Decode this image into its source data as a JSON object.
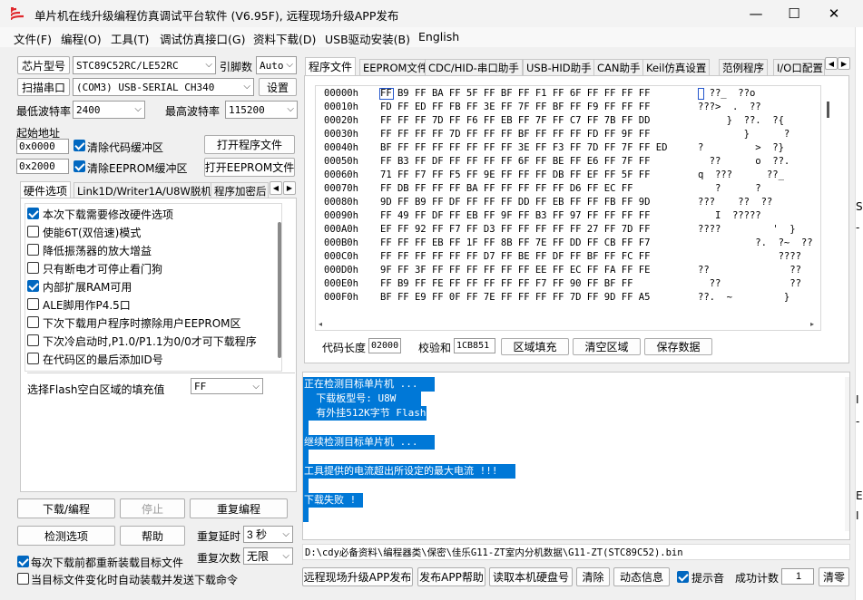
{
  "window": {
    "title": "单片机在线升级编程仿真调试平台软件 (V6.95F), 远程现场升级APP发布",
    "minimize": "—",
    "maximize": "☐",
    "close": "✕"
  },
  "menu": [
    "文件(F)",
    "编程(O)",
    "工具(T)",
    "调试仿真接口(G)",
    "资料下载(D)",
    "USB驱动安装(B)",
    "English"
  ],
  "left": {
    "chip_button": "芯片型号",
    "chip_value": "STC89C52RC/LE52RC",
    "pin_label": "引脚数",
    "pin_value": "Auto",
    "scan_button": "扫描串口",
    "port_value": "(COM3) USB-SERIAL CH340",
    "settings_button": "设置",
    "min_baud_label": "最低波特率",
    "min_baud_value": "2400",
    "max_baud_label": "最高波特率",
    "max_baud_value": "115200",
    "start_addr_label": "起始地址",
    "addr1": "0x0000",
    "clear_code_label": "清除代码缓冲区",
    "open_prog_button": "打开程序文件",
    "addr2": "0x2000",
    "clear_eeprom_label": "清除EEPROM缓冲区",
    "open_eeprom_button": "打开EEPROM文件",
    "tabs": [
      "硬件选项",
      "Link1D/Writer1A/U8W脱机",
      "程序加密后"
    ],
    "options": [
      {
        "label": "本次下载需要修改硬件选项",
        "checked": true
      },
      {
        "label": "使能6T(双倍速)模式",
        "checked": false
      },
      {
        "label": "降低振荡器的放大增益",
        "checked": false
      },
      {
        "label": "只有断电才可停止看门狗",
        "checked": false
      },
      {
        "label": "内部扩展RAM可用",
        "checked": true
      },
      {
        "label": "ALE脚用作P4.5口",
        "checked": false
      },
      {
        "label": "下次下载用户程序时擦除用户EEPROM区",
        "checked": false
      },
      {
        "label": "下次冷启动时,P1.0/P1.1为0/0才可下载程序",
        "checked": false
      },
      {
        "label": "在代码区的最后添加ID号",
        "checked": false
      }
    ],
    "fill_label": "选择Flash空白区域的填充值",
    "fill_value": "FF",
    "download_button": "下载/编程",
    "stop_button": "停止",
    "reprogram_button": "重复编程",
    "check_button": "检测选项",
    "help_button": "帮助",
    "repeat_delay_label": "重复延时",
    "repeat_delay_value": "3 秒",
    "repeat_count_label": "重复次数",
    "repeat_count_value": "无限",
    "reload_label": "每次下载前都重新装载目标文件",
    "reload_checked": true,
    "auto_label": "当目标文件变化时自动装载并发送下载命令",
    "auto_checked": false
  },
  "right": {
    "tabs": [
      "程序文件",
      "EEPROM文件",
      "CDC/HID-串口助手",
      "USB-HID助手",
      "CAN助手",
      "Keil仿真设置",
      "范例程序",
      "I/O口配置"
    ],
    "hex_rows": [
      {
        "addr": "00000h",
        "bytes": "FF B9 FF BA FF 5F FF BF FF F1 FF 6F FF FF FF FF",
        "ascii": "  ??_  ??o"
      },
      {
        "addr": "00010h",
        "bytes": "FD FF ED FF FB FF 3E FF 7F FF BF FF F9 FF FF FF",
        "ascii": "???>  .  ??"
      },
      {
        "addr": "00020h",
        "bytes": "FF FF FF 7D FF F6 FF EB FF 7F FF C7 FF 7B FF DD",
        "ascii": "     }  ??.  ?{"
      },
      {
        "addr": "00030h",
        "bytes": "FF FF FF FF 7D FF FF FF BF FF FF FF FD FF 9F FF",
        "ascii": "        }      ?"
      },
      {
        "addr": "00040h",
        "bytes": "BF FF FF FF FF FF FF FF 3E FF F3 FF 7D FF 7F FF ED",
        "ascii": "?         >  ?}"
      },
      {
        "addr": "00050h",
        "bytes": "FF B3 FF DF FF FF FF FF 6F FF BE FF E6 FF 7F FF",
        "ascii": "  ??      o  ??."
      },
      {
        "addr": "00060h",
        "bytes": "71 FF F7 FF F5 FF 9E FF FF FF DB FF EF FF 5F FF",
        "ascii": "q  ???      ??_"
      },
      {
        "addr": "00070h",
        "bytes": "FF DB FF FF FF BA FF FF FF FF FF D6 FF EC FF",
        "ascii": "   ?      ?"
      },
      {
        "addr": "00080h",
        "bytes": "9D FF B9 FF DF FF FF FF DD FF EB FF FF FB FF 9D",
        "ascii": "???    ??  ??"
      },
      {
        "addr": "00090h",
        "bytes": "FF 49 FF DF FF EB FF 9F FF B3 FF 97 FF FF FF FF",
        "ascii": "   I  ?????"
      },
      {
        "addr": "000A0h",
        "bytes": "EF FF 92 FF F7 FF D3 FF FF FF FF FF 27 FF 7D FF",
        "ascii": "????         '  }"
      },
      {
        "addr": "000B0h",
        "bytes": "FF FF FF EB FF 1F FF 8B FF 7E FF DD FF CB FF F7",
        "ascii": "          ?.  ?~  ??"
      },
      {
        "addr": "000C0h",
        "bytes": "FF FF FF FF FF FF D7 FF BE FF DF FF BF FF FC FF",
        "ascii": "              ????"
      },
      {
        "addr": "000D0h",
        "bytes": "9F FF 3F FF FF FF FF FF FF EE FF EC FF FA FF FE",
        "ascii": "??              ??"
      },
      {
        "addr": "000E0h",
        "bytes": "FF B9 FF FE FF FF FF FF FF F7 FF 90 FF BF FF",
        "ascii": "  ??            ??"
      },
      {
        "addr": "000F0h",
        "bytes": "BF FF E9 FF 0F FF 7E FF FF FF FF 7D FF 9D FF A5",
        "ascii": "??.  ~         }"
      }
    ],
    "code_len_label": "代码长度",
    "code_len_value": "02000",
    "checksum_label": "校验和",
    "checksum_value": "1CB851",
    "fill_button": "区域填充",
    "clear_button": "清空区域",
    "save_button": "保存数据",
    "log": [
      "正在检测目标单片机 ...",
      "  下载板型号: U8W",
      "  有外挂512K字节 Flash",
      " ",
      "继续检测目标单片机 ...",
      " ",
      "工具提供的电流超出所设定的最大电流 !!!",
      " ",
      "下载失败 !",
      " "
    ],
    "file_path": "D:\\cdy必备资料\\编程器类\\保密\\佳乐G11-ZT室内分机数据\\G11-ZT(STC89C52).bin",
    "publish_button": "远程现场升级APP发布",
    "publish_help_button": "发布APP帮助",
    "read_disk_button": "读取本机硬盘号",
    "clear_log_button": "清除",
    "anim_button": "动态信息",
    "beep_label": "提示音",
    "beep_checked": true,
    "success_label": "成功计数",
    "success_value": "1",
    "reset_button": "清零"
  },
  "background_fragments": [
    "S",
    "-",
    "I",
    "-",
    "E",
    "I"
  ]
}
